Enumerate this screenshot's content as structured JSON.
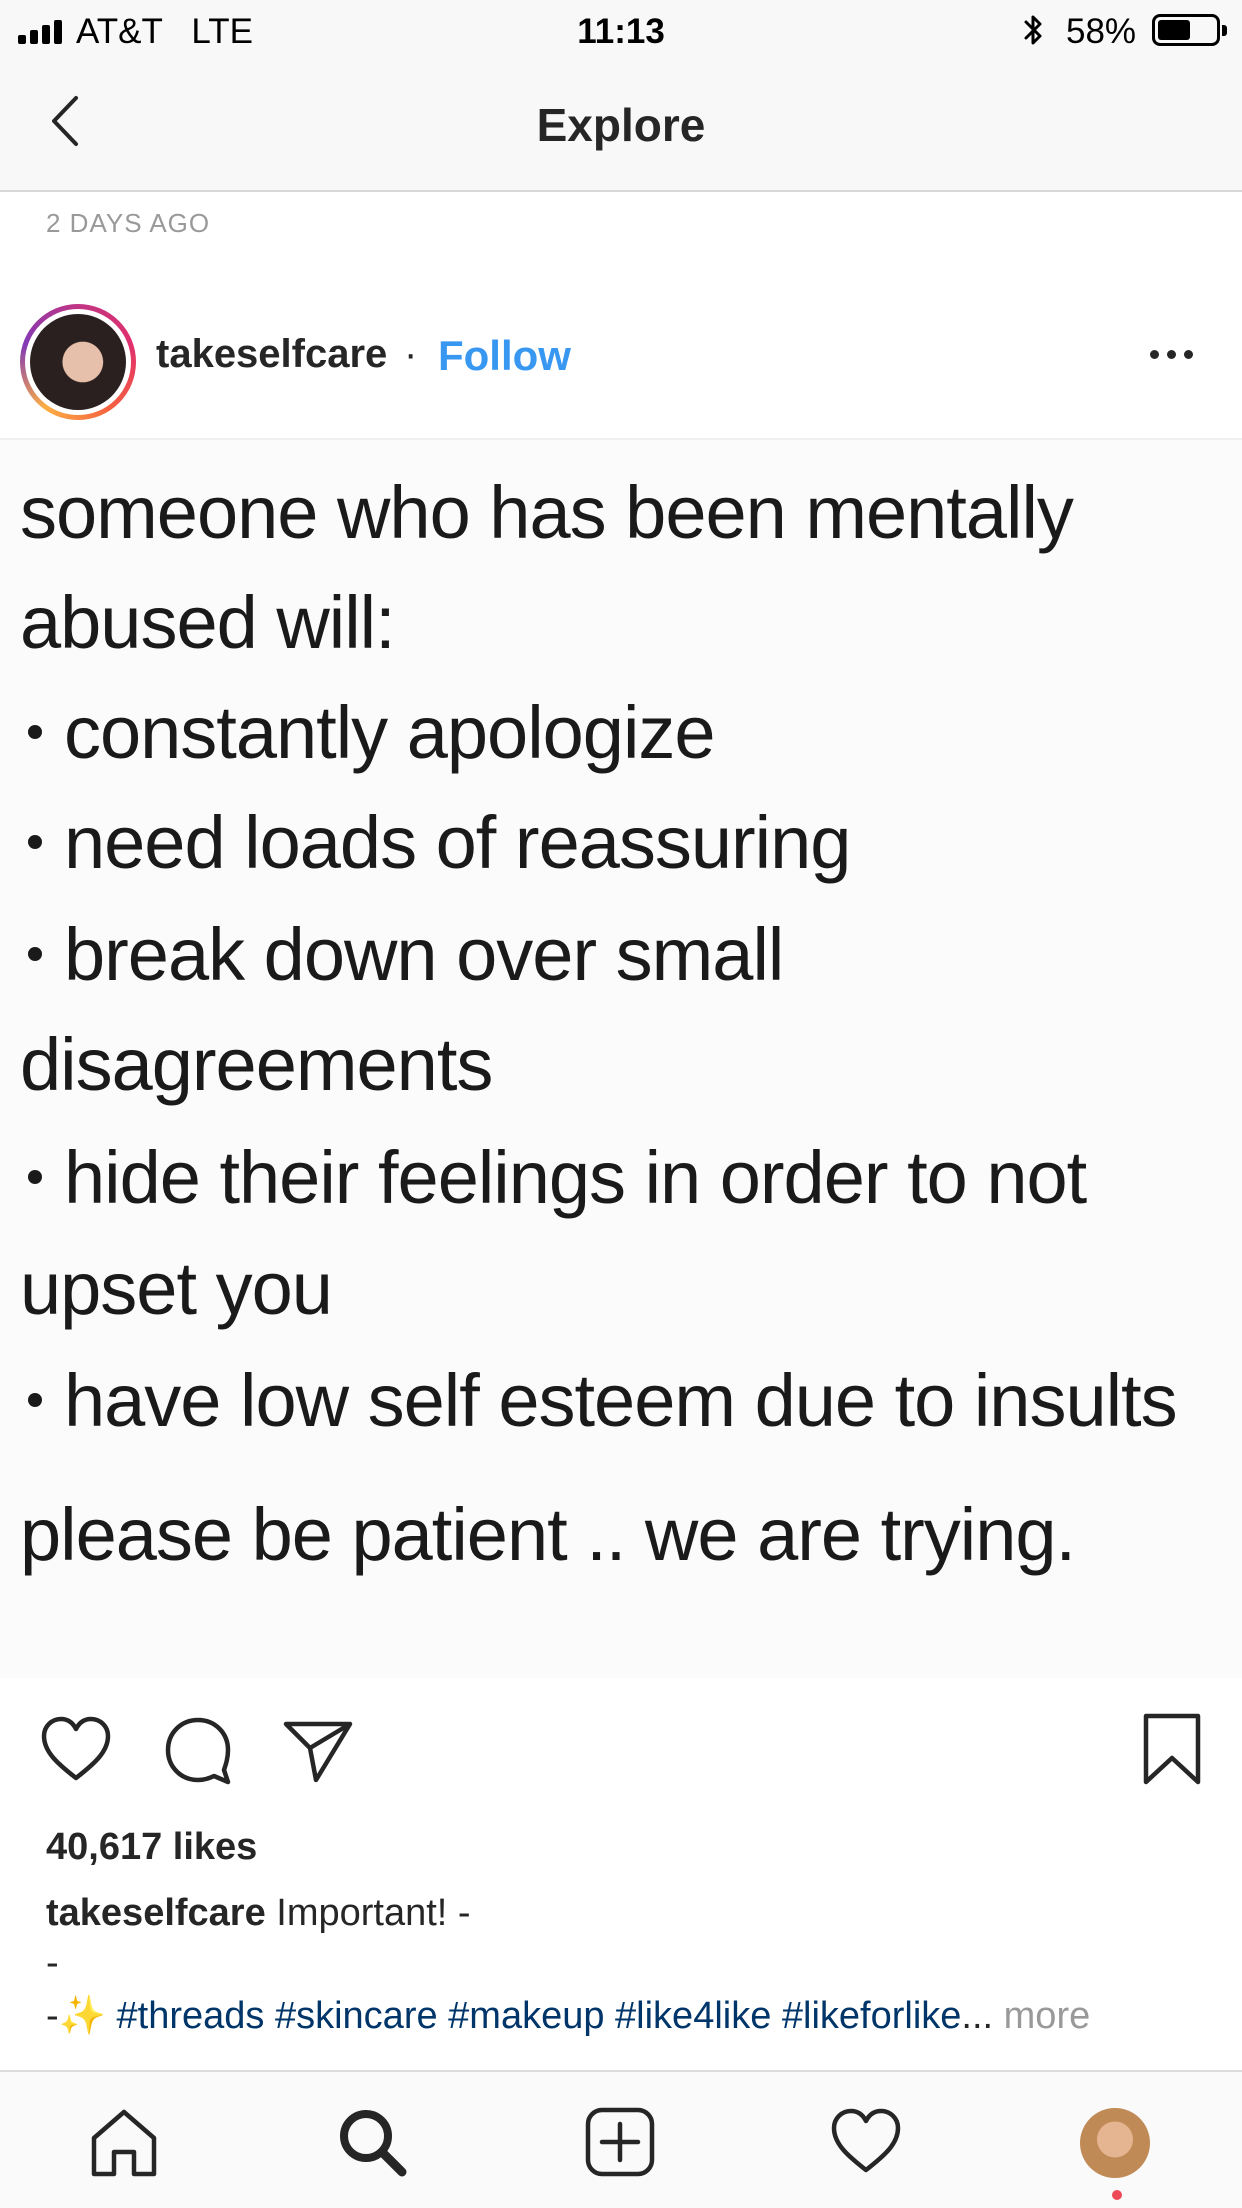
{
  "status_bar": {
    "carrier": "AT&T   LTE",
    "time": "11:13",
    "battery_percent": "58%",
    "battery_level": 0.58,
    "signal_bars": 4
  },
  "nav": {
    "title": "Explore",
    "back_icon": "chevron-left-icon"
  },
  "post": {
    "time_ago": "2 DAYS AGO",
    "username": "takeselfcare",
    "separator": "·",
    "follow_label": "Follow",
    "more_icon": "ellipsis-icon",
    "image_text": {
      "line1": "someone who has been mentally",
      "line2": "abused will:",
      "line3": "constantly apologize",
      "line4": "need loads of reassuring",
      "line5": "break down over small",
      "line6": "disagreements",
      "line7": "hide their feelings in order to not",
      "line8": "upset you",
      "line9": "have low self esteem due to insults",
      "line10": "please be patient .. we are trying."
    },
    "likes": "40,617 likes",
    "caption_user": "takeselfcare",
    "caption_text": " Important! -",
    "caption_dash": "-",
    "caption_prefix": "-✨ ",
    "caption_tags": "#threads #skincare #makeup #like4like #likeforlike",
    "caption_ellipsis": "... ",
    "more_label": "more"
  },
  "tabs": {
    "home_icon": "home-icon",
    "search_icon": "search-icon",
    "new_post_icon": "plus-square-icon",
    "activity_icon": "heart-icon",
    "profile_icon": "profile-avatar"
  },
  "colors": {
    "follow_blue": "#3897f0",
    "hashtag_navy": "#003569",
    "notification_red": "#ed4956"
  }
}
